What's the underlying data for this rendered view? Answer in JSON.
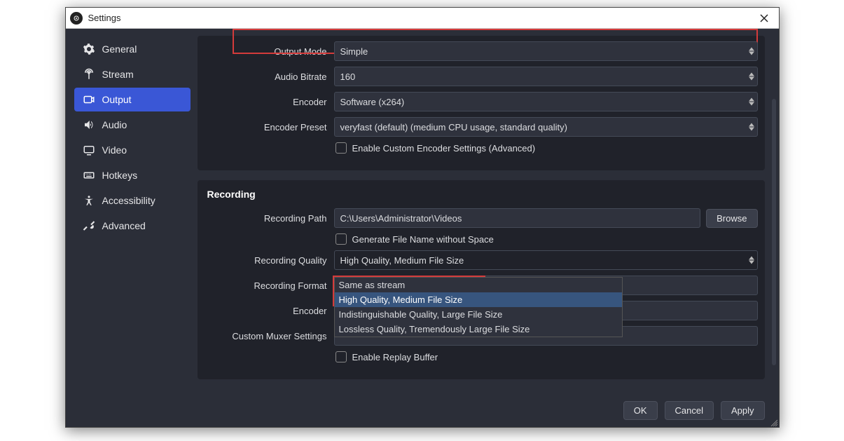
{
  "window": {
    "title": "Settings"
  },
  "sidebar": {
    "items": [
      {
        "label": "General"
      },
      {
        "label": "Stream"
      },
      {
        "label": "Output"
      },
      {
        "label": "Audio"
      },
      {
        "label": "Video"
      },
      {
        "label": "Hotkeys"
      },
      {
        "label": "Accessibility"
      },
      {
        "label": "Advanced"
      }
    ]
  },
  "form": {
    "output_mode": {
      "label": "Output Mode",
      "value": "Simple"
    },
    "audio_bitrate": {
      "label": "Audio Bitrate",
      "value": "160"
    },
    "encoder": {
      "label": "Encoder",
      "value": "Software (x264)"
    },
    "encoder_preset": {
      "label": "Encoder Preset",
      "value": "veryfast (default) (medium CPU usage, standard quality)"
    },
    "enable_custom_encoder": {
      "label": "Enable Custom Encoder Settings (Advanced)"
    },
    "recording_section": "Recording",
    "recording_path": {
      "label": "Recording Path",
      "value": "C:\\Users\\Administrator\\Videos",
      "browse": "Browse"
    },
    "generate_filename": {
      "label": "Generate File Name without Space"
    },
    "recording_quality": {
      "label": "Recording Quality",
      "value": "High Quality, Medium File Size",
      "options": [
        "Same as stream",
        "High Quality, Medium File Size",
        "Indistinguishable Quality, Large File Size",
        "Lossless Quality, Tremendously Large File Size"
      ]
    },
    "recording_format": {
      "label": "Recording Format"
    },
    "rec_encoder": {
      "label": "Encoder"
    },
    "custom_muxer": {
      "label": "Custom Muxer Settings"
    },
    "enable_replay_buffer": {
      "label": "Enable Replay Buffer"
    }
  },
  "footer": {
    "ok": "OK",
    "cancel": "Cancel",
    "apply": "Apply"
  }
}
